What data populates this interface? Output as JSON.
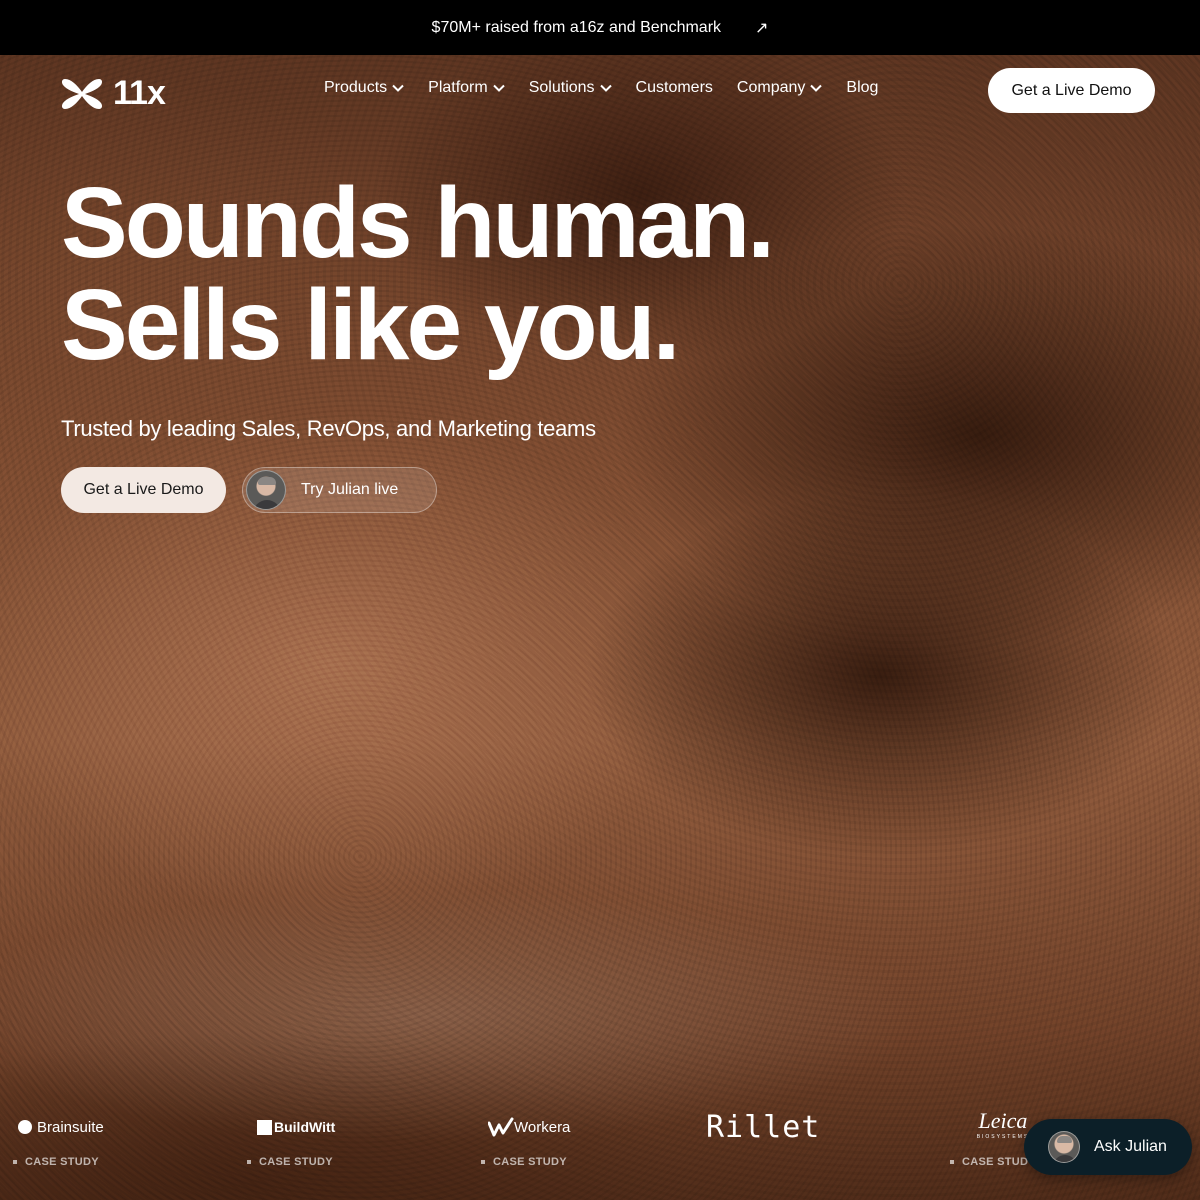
{
  "announcement": {
    "text": "$70M+ raised from a16z and Benchmark",
    "arrow": "↗"
  },
  "header": {
    "logo_text": "11x",
    "nav": [
      {
        "label": "Products",
        "has_dropdown": true
      },
      {
        "label": "Platform",
        "has_dropdown": true
      },
      {
        "label": "Solutions",
        "has_dropdown": true
      },
      {
        "label": "Customers",
        "has_dropdown": false
      },
      {
        "label": "Company",
        "has_dropdown": true
      },
      {
        "label": "Blog",
        "has_dropdown": false
      }
    ],
    "cta_label": "Get a Live Demo"
  },
  "hero": {
    "headline_line1": "Sounds human.",
    "headline_line2": "Sells like you.",
    "subhead": "Trusted by leading Sales, RevOps, and Marketing teams",
    "primary_cta": "Get a Live Demo",
    "secondary_cta": "Try Julian live"
  },
  "customers": [
    {
      "name": "Brainsuite",
      "tag": "CASE STUDY"
    },
    {
      "name": "BuildWitt",
      "tag": "CASE STUDY"
    },
    {
      "name": "Workera",
      "tag": "CASE STUDY"
    },
    {
      "name": "Rillet",
      "tag": ""
    },
    {
      "name": "Leica",
      "subname": "BIOSYSTEMS",
      "tag": "CASE STUDY"
    }
  ],
  "ask_widget": {
    "label": "Ask Julian"
  },
  "colors": {
    "announcement_bg": "#000000",
    "primary_button_bg": "#f3e9e3",
    "header_cta_bg": "#ffffff",
    "widget_bg": "#0c1f28"
  },
  "icons": {
    "logo": "11x-logo-icon",
    "external": "arrow-up-right-icon",
    "dropdown": "chevron-down-icon"
  }
}
